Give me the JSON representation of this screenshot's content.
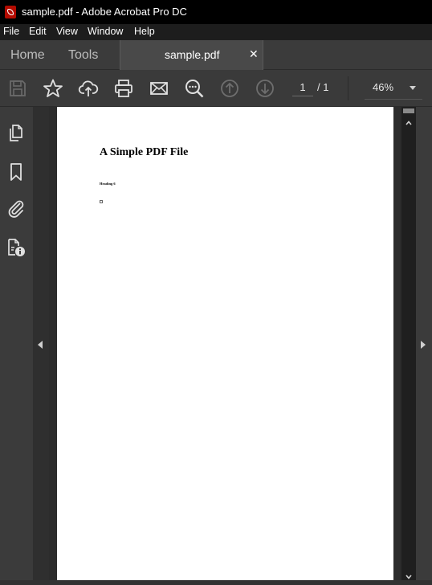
{
  "window": {
    "title": "sample.pdf - Adobe Acrobat Pro DC"
  },
  "menu": {
    "items": [
      "File",
      "Edit",
      "View",
      "Window",
      "Help"
    ]
  },
  "tabs": {
    "home": "Home",
    "tools": "Tools",
    "document": "sample.pdf",
    "close_glyph": "✕"
  },
  "toolbar": {
    "icons": [
      "save-icon",
      "star-icon",
      "cloud-upload-icon",
      "print-icon",
      "mail-icon",
      "zoom-search-icon",
      "page-up-icon",
      "page-down-icon"
    ],
    "current_page": "1",
    "page_total": "/ 1",
    "zoom": "46%"
  },
  "left_panel": {
    "icons": [
      "pages-icon",
      "bookmark-icon",
      "attachment-icon",
      "document-properties-icon"
    ]
  },
  "document": {
    "title": "A Simple PDF File",
    "heading": "Heading 6"
  },
  "colors": {
    "titlebar": "#000000",
    "menubar": "#1d1d1d",
    "chrome": "#3b3b3b",
    "active_tab": "#494949",
    "page": "#ffffff",
    "acrobat_red": "#b30b00"
  }
}
